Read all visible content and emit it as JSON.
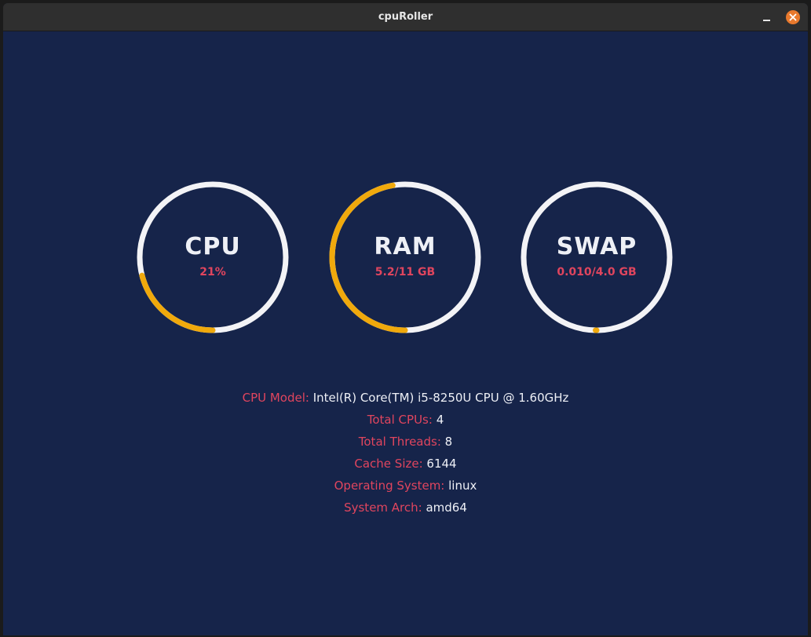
{
  "window": {
    "title": "cpuRoller"
  },
  "colors": {
    "background": "#16244a",
    "ring_track": "#f3f3f6",
    "ring_fill": "#f0a90c",
    "accent": "#e0455e",
    "text": "#eef0f6"
  },
  "gauges": [
    {
      "label": "CPU",
      "value": "21%",
      "fraction": 0.21
    },
    {
      "label": "RAM",
      "value": "5.2/11 GB",
      "fraction": 0.473
    },
    {
      "label": "SWAP",
      "value": "0.010/4.0 GB",
      "fraction": 0.0025
    }
  ],
  "info": [
    {
      "key": "CPU Model:",
      "value": "Intel(R) Core(TM) i5-8250U CPU @ 1.60GHz"
    },
    {
      "key": "Total CPUs:",
      "value": "4"
    },
    {
      "key": "Total Threads:",
      "value": "8"
    },
    {
      "key": "Cache Size:",
      "value": "6144"
    },
    {
      "key": "Operating System:",
      "value": "linux"
    },
    {
      "key": "System Arch:",
      "value": "amd64"
    }
  ]
}
